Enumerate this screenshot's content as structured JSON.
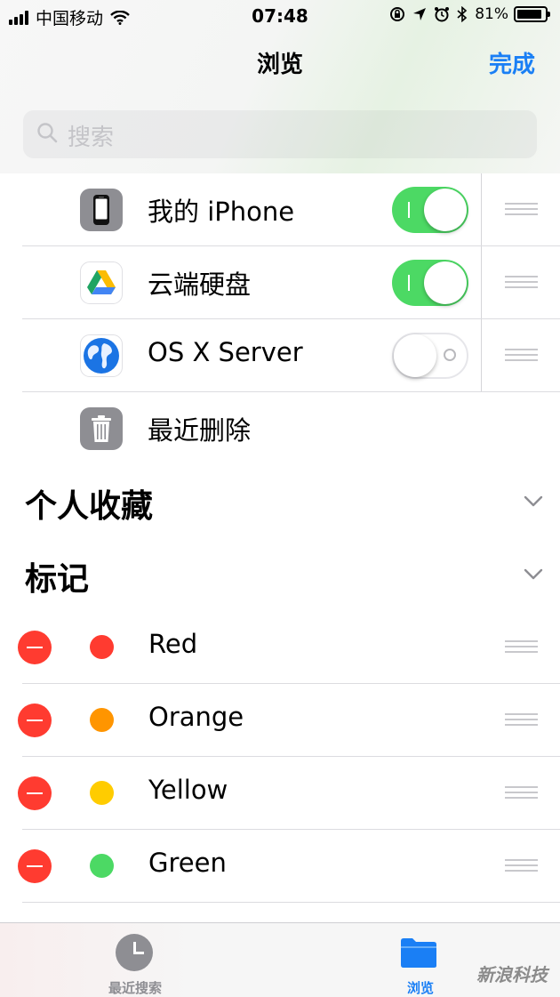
{
  "status_bar": {
    "carrier": "中国移动",
    "time": "07:48",
    "battery": "81%"
  },
  "nav": {
    "title": "浏览",
    "done_label": "完成"
  },
  "search": {
    "placeholder": "搜索"
  },
  "locations": [
    {
      "label": "我的 iPhone",
      "icon": "iphone-icon",
      "enabled": true
    },
    {
      "label": "云端硬盘",
      "icon": "google-drive-icon",
      "enabled": true
    },
    {
      "label": "OS X Server",
      "icon": "globe-icon",
      "enabled": false
    },
    {
      "label": "最近删除",
      "icon": "trash-icon"
    }
  ],
  "sections": {
    "favorites": "个人收藏",
    "tags": "标记"
  },
  "tags": [
    {
      "label": "Red",
      "color": "#ff3b30"
    },
    {
      "label": "Orange",
      "color": "#ff9500"
    },
    {
      "label": "Yellow",
      "color": "#ffcc00"
    },
    {
      "label": "Green",
      "color": "#4cd964"
    }
  ],
  "tabbar": {
    "recents": "最近搜索",
    "browse": "浏览"
  },
  "watermark": "新浪科技",
  "colors": {
    "accent": "#1a7ff5",
    "toggle_on": "#4cd964",
    "delete": "#ff3b30"
  }
}
